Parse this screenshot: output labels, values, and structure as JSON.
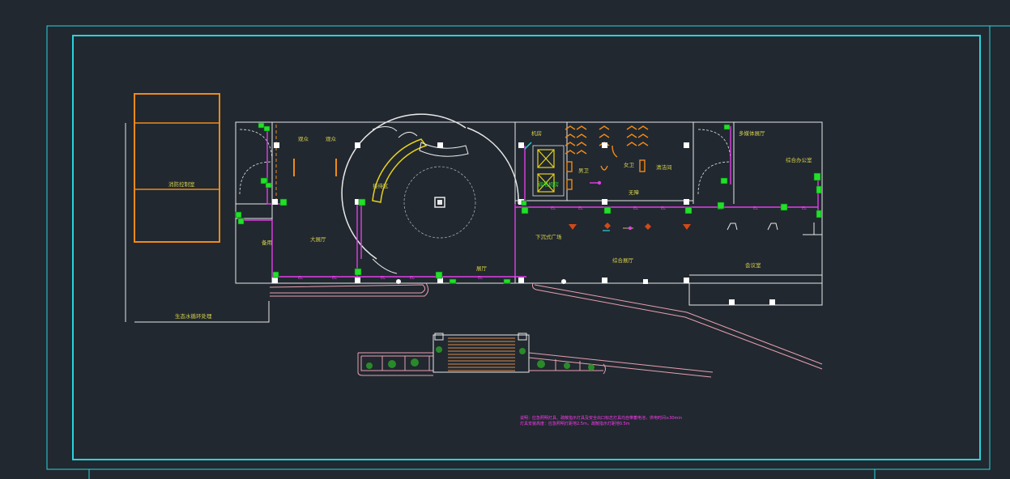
{
  "colors": {
    "background": "#212830",
    "frame": "#29d3dc",
    "wall": "#e8e8e8",
    "circuit": "#e23ee8",
    "accent_orange": "#f08a18",
    "accent_yellow": "#e8d21a",
    "label_yellow": "#d8d24a",
    "railing_pink": "#e8a0b0",
    "fixture_green": "#22e02a",
    "note_magenta": "#ff3af0"
  },
  "rooms": {
    "r1": "观众",
    "r2": "观众",
    "r3": "机房",
    "r4": "男卫",
    "r5": "女卫",
    "r6": "清洁间",
    "r7": "无障",
    "r8": "多媒体展厅",
    "r9": "备用",
    "r10": "展厅",
    "r11": "下沉式广场",
    "r12": "综合展厅",
    "r13": "会议室",
    "r14": "大展厅",
    "r15": "综合办公室",
    "r16": "消防控制室",
    "r17": "弱电机房",
    "r18": "接待区",
    "left_bottom_label": "生态水循环处理"
  },
  "circuit_label": "EL",
  "notes": {
    "line1": "说明：应急照明灯具、疏散指示灯具及安全出口标志灯具均自带蓄电池，供电时间≥30min",
    "line2": "灯具安装高度：应急照明灯距地2.5m，疏散指示灯距地0.5m"
  }
}
